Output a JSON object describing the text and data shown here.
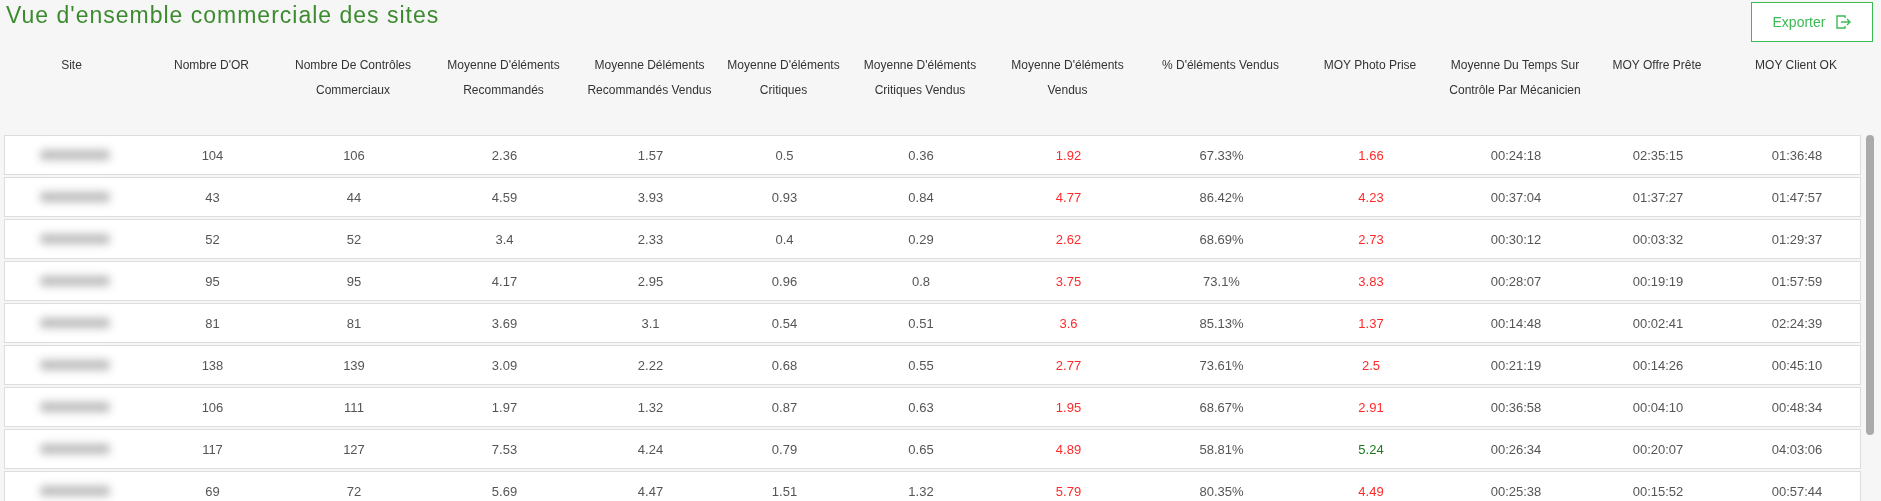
{
  "title": "Vue d'ensemble commerciale des sites",
  "export_button": {
    "label": "Exporter"
  },
  "table": {
    "columns": [
      "Site",
      "Nombre D'OR",
      "Nombre De Contrôles Commerciaux",
      "Moyenne D'éléments Recommandés",
      "Moyenne Déléments Recommandés Vendus",
      "Moyenne D'éléments Critiques",
      "Moyenne D'éléments Critiques Vendus",
      "Moyenne D'éléments Vendus",
      "% D'éléments Vendus",
      "MOY Photo Prise",
      "Moyenne Du Temps Sur Contrôle Par Mécanicien",
      "MOY Offre Prête",
      "MOY Client OK"
    ],
    "rows": [
      {
        "cells": [
          {
            "kind": "blurred"
          },
          "104",
          "106",
          "2.36",
          "1.57",
          "0.5",
          "0.36",
          {
            "text": "1.92",
            "color": "#ff2a2a"
          },
          "67.33%",
          {
            "text": "1.66",
            "color": "#ff2a2a"
          },
          "00:24:18",
          "02:35:15",
          "01:36:48"
        ]
      },
      {
        "cells": [
          {
            "kind": "blurred"
          },
          "43",
          "44",
          "4.59",
          "3.93",
          "0.93",
          "0.84",
          {
            "text": "4.77",
            "color": "#ff2a2a"
          },
          "86.42%",
          {
            "text": "4.23",
            "color": "#ff2a2a"
          },
          "00:37:04",
          "01:37:27",
          "01:47:57"
        ]
      },
      {
        "cells": [
          {
            "kind": "blurred"
          },
          "52",
          "52",
          "3.4",
          "2.33",
          "0.4",
          "0.29",
          {
            "text": "2.62",
            "color": "#ff2a2a"
          },
          "68.69%",
          {
            "text": "2.73",
            "color": "#ff2a2a"
          },
          "00:30:12",
          "00:03:32",
          "01:29:37"
        ]
      },
      {
        "cells": [
          {
            "kind": "blurred"
          },
          "95",
          "95",
          "4.17",
          "2.95",
          "0.96",
          "0.8",
          {
            "text": "3.75",
            "color": "#ff2a2a"
          },
          "73.1%",
          {
            "text": "3.83",
            "color": "#ff2a2a"
          },
          "00:28:07",
          "00:19:19",
          "01:57:59"
        ]
      },
      {
        "cells": [
          {
            "kind": "blurred"
          },
          "81",
          "81",
          "3.69",
          "3.1",
          "0.54",
          "0.51",
          {
            "text": "3.6",
            "color": "#ff2a2a"
          },
          "85.13%",
          {
            "text": "1.37",
            "color": "#ff2a2a"
          },
          "00:14:48",
          "00:02:41",
          "02:24:39"
        ]
      },
      {
        "cells": [
          {
            "kind": "blurred"
          },
          "138",
          "139",
          "3.09",
          "2.22",
          "0.68",
          "0.55",
          {
            "text": "2.77",
            "color": "#ff2a2a"
          },
          "73.61%",
          {
            "text": "2.5",
            "color": "#ff2a2a"
          },
          "00:21:19",
          "00:14:26",
          "00:45:10"
        ]
      },
      {
        "cells": [
          {
            "kind": "blurred"
          },
          "106",
          "111",
          "1.97",
          "1.32",
          "0.87",
          "0.63",
          {
            "text": "1.95",
            "color": "#ff2a2a"
          },
          "68.67%",
          {
            "text": "2.91",
            "color": "#ff2a2a"
          },
          "00:36:58",
          "00:04:10",
          "00:48:34"
        ]
      },
      {
        "cells": [
          {
            "kind": "blurred"
          },
          "117",
          "127",
          "7.53",
          "4.24",
          "0.79",
          "0.65",
          {
            "text": "4.89",
            "color": "#ff2a2a"
          },
          "58.81%",
          {
            "text": "5.24",
            "color": "#1e7a1e"
          },
          "00:26:34",
          "00:20:07",
          "04:03:06"
        ]
      },
      {
        "cells": [
          {
            "kind": "blurred"
          },
          "69",
          "72",
          "5.69",
          "4.47",
          "1.51",
          "1.32",
          {
            "text": "5.79",
            "color": "#ff2a2a"
          },
          "80.35%",
          {
            "text": "4.49",
            "color": "#ff2a2a"
          },
          "00:25:38",
          "00:15:52",
          "00:57:44"
        ]
      }
    ]
  }
}
